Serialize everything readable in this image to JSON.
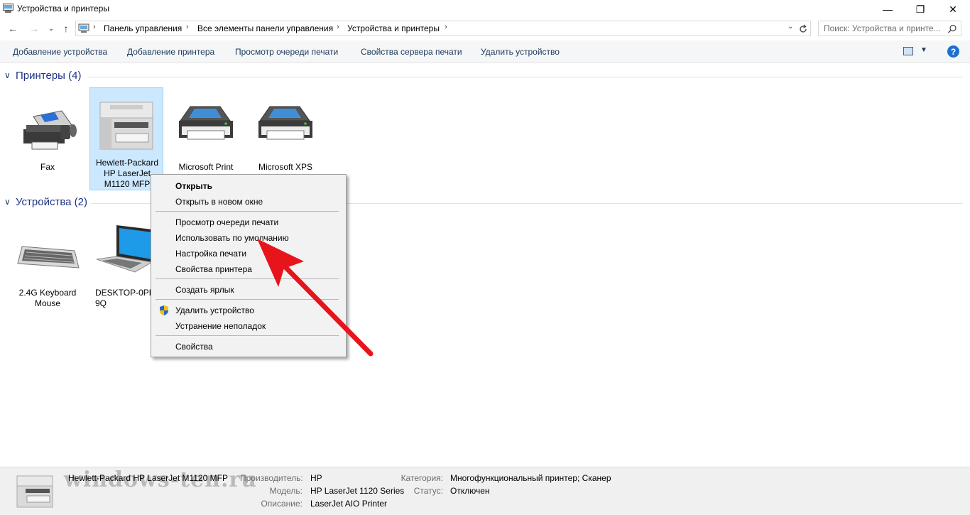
{
  "window": {
    "title": "Устройства и принтеры",
    "controls": {
      "minimize": "—",
      "maximize": "❐",
      "close": "✕"
    }
  },
  "nav": {
    "back": "←",
    "forward": "→",
    "recent": "⌄",
    "up": "↑",
    "breadcrumbs": [
      "Панель управления",
      "Все элементы панели управления",
      "Устройства и принтеры"
    ],
    "separator": "›",
    "search_placeholder": "Поиск: Устройства и принте..."
  },
  "commands": {
    "add_device": "Добавление устройства",
    "add_printer": "Добавление принтера",
    "print_queue": "Просмотр очереди печати",
    "server_props": "Свойства сервера печати",
    "remove_device": "Удалить устройство",
    "help": "?"
  },
  "groups": {
    "printers": {
      "title": "Принтеры (4)",
      "items": [
        {
          "label": "Fax"
        },
        {
          "label": "Hewlett-Packard\nHP LaserJet\nM1120 MFP"
        },
        {
          "label": "Microsoft Print\nto PDF"
        },
        {
          "label": "Microsoft XPS\nDocument Writer"
        }
      ]
    },
    "devices": {
      "title": "Устройства (2)",
      "items": [
        {
          "label": "2.4G Keyboard\nMouse"
        },
        {
          "label": "DESKTOP-0PRU\n9Q"
        }
      ]
    }
  },
  "context_menu": {
    "open": "Открыть",
    "open_new_window": "Открыть в новом окне",
    "view_queue": "Просмотр очереди печати",
    "set_default": "Использовать по умолчанию",
    "print_settings": "Настройка печати",
    "printer_props": "Свойства принтера",
    "create_shortcut": "Создать ярлык",
    "remove_device": "Удалить устройство",
    "troubleshoot": "Устранение неполадок",
    "properties": "Свойства"
  },
  "details": {
    "device_name": "Hewlett-Packard HP LaserJet M1120 MFP",
    "watermark": "windows-ten.ru",
    "manufacturer_label": "Производитель:",
    "manufacturer": "HP",
    "model_label": "Модель:",
    "model": "HP LaserJet 1120 Series",
    "description_label": "Описание:",
    "description": "LaserJet AIO Printer",
    "category_label": "Категория:",
    "category": "Многофункциональный принтер; Сканер",
    "status_label": "Статус:",
    "status": "Отключен"
  },
  "colors": {
    "selection_bg": "#cce8ff",
    "header_text": "#1e3287",
    "arrow": "#e8141b",
    "help_icon": "#1f6fd0"
  }
}
